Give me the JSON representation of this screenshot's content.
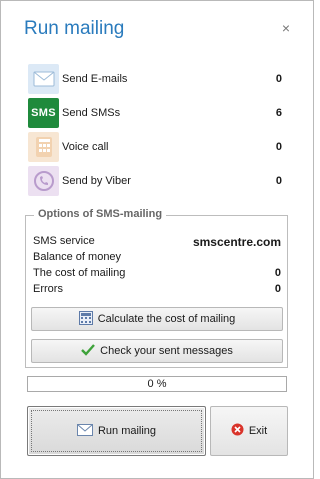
{
  "window": {
    "title": "Run mailing",
    "close_glyph": "×"
  },
  "channels": [
    {
      "label": "Send E-mails",
      "count": "0",
      "icon": "envelope-icon"
    },
    {
      "label": "Send SMSs",
      "count": "6",
      "icon": "sms-icon",
      "icon_text": "SMS"
    },
    {
      "label": "Voice call",
      "count": "0",
      "icon": "phone-icon"
    },
    {
      "label": "Send by Viber",
      "count": "0",
      "icon": "viber-icon"
    }
  ],
  "options": {
    "title": "Options of SMS-mailing",
    "service_label": "SMS service",
    "service_value": "smscentre.com",
    "balance_label": "Balance of money",
    "balance_value": "",
    "cost_label": "The cost of mailing",
    "cost_value": "0",
    "errors_label": "Errors",
    "errors_value": "0",
    "calculate_label": "Calculate the cost of mailing",
    "check_label": "Check your sent messages"
  },
  "progress": {
    "value": 0,
    "label": "0 %"
  },
  "actions": {
    "run_label": "Run mailing",
    "exit_label": "Exit"
  },
  "colors": {
    "title": "#2a7bbd",
    "sms_icon_bg": "#1f8a3c",
    "exit_icon": "#d9342b"
  }
}
